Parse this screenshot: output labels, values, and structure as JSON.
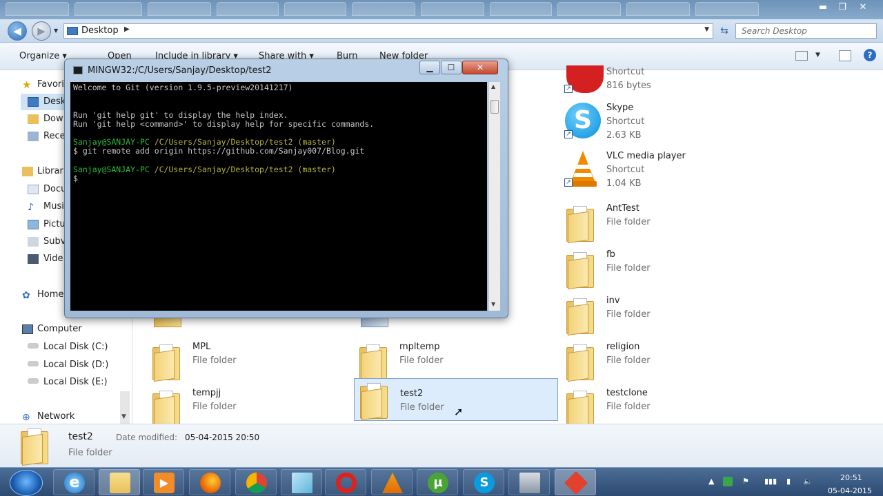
{
  "explorer": {
    "address": {
      "location": "Desktop"
    },
    "search_placeholder": "Search Desktop",
    "commands": [
      "Organize ▾",
      "Open",
      "Include in library ▾",
      "Share with ▾",
      "Burn",
      "New folder"
    ]
  },
  "nav": {
    "favorites": "Favori",
    "desktop": "Desk",
    "downloads": "Dow",
    "recent": "Rece",
    "libraries": "Librari",
    "documents": "Docu",
    "music": "Musi",
    "pictures": "Pictu",
    "subversion": "Subv",
    "videos": "Vide",
    "homegroup": "Home",
    "computer": "Computer",
    "disk_c": "Local Disk (C:)",
    "disk_d": "Local Disk (D:)",
    "disk_e": "Local Disk (E:)",
    "network": "Network"
  },
  "files": {
    "shortcut1": {
      "type": "Shortcut",
      "size": "816 bytes"
    },
    "skype": {
      "name": "Skype",
      "type": "Shortcut",
      "size": "2.63 KB"
    },
    "vlc": {
      "name": "VLC media player",
      "type": "Shortcut",
      "size": "1.04 KB"
    },
    "anttest": {
      "name": "AntTest",
      "type": "File folder"
    },
    "fb": {
      "name": "fb",
      "type": "File folder"
    },
    "inv": {
      "name": "inv",
      "type": "File folder"
    },
    "mpl": {
      "name": "MPL",
      "type": "File folder"
    },
    "mpltemp": {
      "name": "mpltemp",
      "type": "File folder"
    },
    "religion": {
      "name": "religion",
      "type": "File folder"
    },
    "tempjj": {
      "name": "tempjj",
      "type": "File folder"
    },
    "test2": {
      "name": "test2",
      "type": "File folder"
    },
    "testclone": {
      "name": "testclone",
      "type": "File folder"
    }
  },
  "details": {
    "name": "test2",
    "modified_label": "Date modified:",
    "modified_value": "05-04-2015 20:50",
    "type": "File folder"
  },
  "terminal": {
    "title": "MINGW32:/C/Users/Sanjay/Desktop/test2",
    "lines": {
      "welcome": "Welcome to Git (version 1.9.5-preview20141217)",
      "help1": "Run 'git help git' to display the help index.",
      "help2": "Run 'git help <command>' to display help for specific commands.",
      "prompt1_user": "Sanjay@SANJAY-PC",
      "prompt1_path": " /C/Users/Sanjay/Desktop/test2 (master)",
      "cmd1": "$ git remote add origin https://github.com/Sanjay007/Blog.git",
      "prompt2_user": "Sanjay@SANJAY-PC",
      "prompt2_path": " /C/Users/Sanjay/Desktop/test2 (master)",
      "cursor": "$"
    }
  },
  "taskbar": {
    "time": "20:51",
    "date": "05-04-2015",
    "apps": [
      "internet-explorer",
      "file-explorer",
      "media-player",
      "firefox",
      "chrome",
      "notepad",
      "opera",
      "vlc",
      "utorrent",
      "skype",
      "desktop-app",
      "git-bash"
    ]
  },
  "colors": {
    "console_bg": "#000000",
    "prompt_green": "#2dbb3a",
    "prompt_path": "#b6b23c",
    "selection": "#dcecfc"
  }
}
